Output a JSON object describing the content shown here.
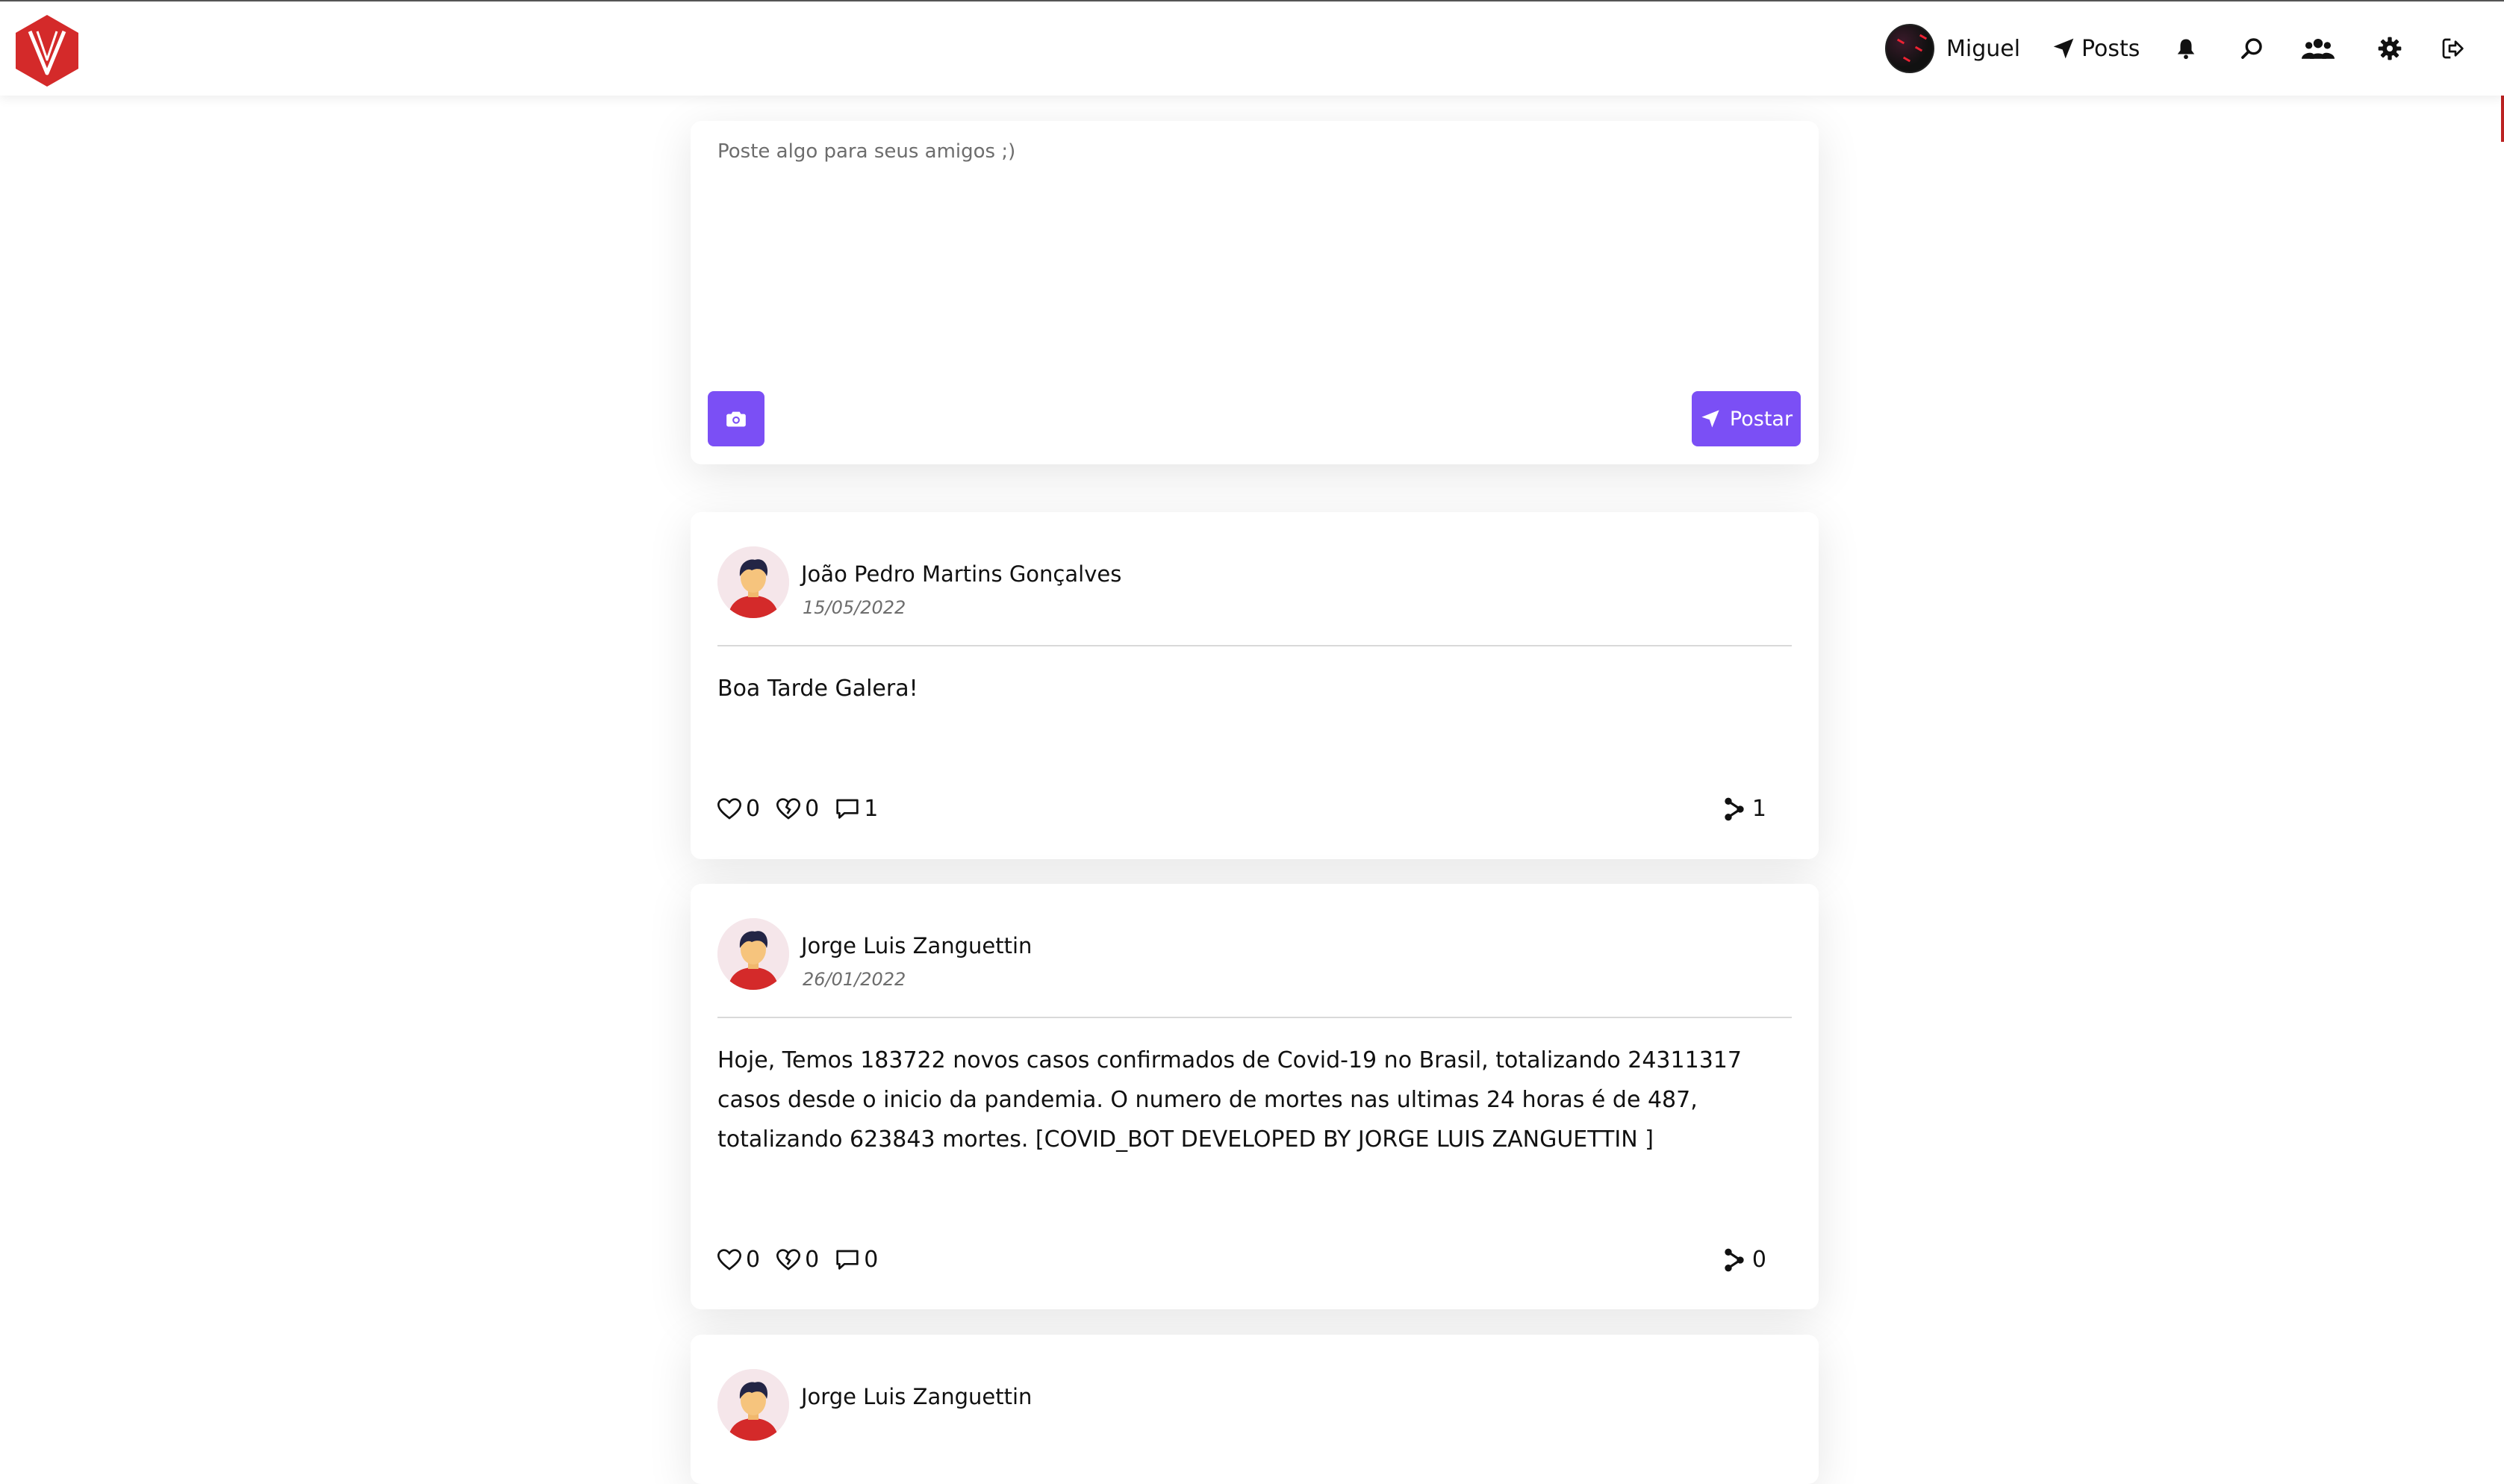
{
  "nav": {
    "user_name": "Miguel",
    "posts_label": "Posts",
    "icons": [
      "bell-icon",
      "search-icon",
      "users-icon",
      "gear-icon",
      "logout-icon"
    ]
  },
  "composer": {
    "placeholder": "Poste algo para seus amigos ;)",
    "post_label": "Postar"
  },
  "colors": {
    "accent": "#7b4ff5",
    "brand": "#d42a2a"
  },
  "posts": [
    {
      "author": "João Pedro Martins Gonçalves",
      "date": "15/05/2022",
      "text": "Boa Tarde Galera!",
      "likes": "0",
      "dislikes": "0",
      "comments": "1",
      "shares": "1"
    },
    {
      "author": "Jorge Luis Zanguettin",
      "date": "26/01/2022",
      "text": "Hoje, Temos 183722 novos casos confirmados de Covid-19 no Brasil, totalizando 24311317 casos desde o inicio da pandemia. O numero de mortes nas ultimas 24 horas é de 487, totalizando 623843 mortes. [COVID_BOT DEVELOPED BY JORGE LUIS ZANGUETTIN ]",
      "likes": "0",
      "dislikes": "0",
      "comments": "0",
      "shares": "0"
    },
    {
      "author": "Jorge Luis Zanguettin"
    }
  ]
}
